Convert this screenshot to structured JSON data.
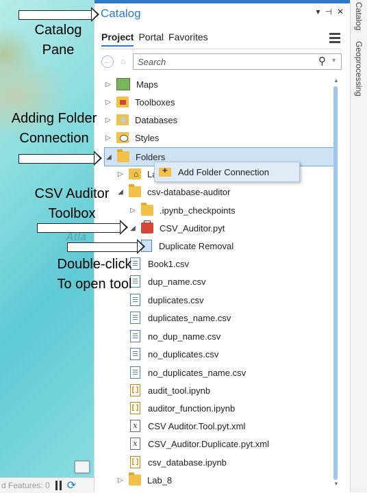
{
  "annotations": {
    "catalog_pane": [
      "Catalog",
      "Pane"
    ],
    "adding_folder": [
      "Adding Folder",
      "Connection"
    ],
    "csv_auditor": [
      "CSV Auditor",
      "Toolbox"
    ],
    "double_click": [
      "Double-click",
      "To open tool"
    ]
  },
  "map": {
    "status_text": "d Features: 0",
    "label_fragment": "Atla"
  },
  "pane": {
    "title": "Catalog",
    "controls": [
      "▾",
      "⊣",
      "✕"
    ],
    "tabs": [
      {
        "label": "Project",
        "active": true
      },
      {
        "label": "Portal",
        "active": false
      },
      {
        "label": "Favorites",
        "active": false
      }
    ],
    "search": {
      "placeholder": "Search",
      "value": ""
    }
  },
  "tree": [
    {
      "label": "Maps",
      "icon": "maps-folder-icon",
      "expanded": false
    },
    {
      "label": "Toolboxes",
      "icon": "toolbox-folder-icon",
      "expanded": false
    },
    {
      "label": "Databases",
      "icon": "database-folder-icon",
      "expanded": false
    },
    {
      "label": "Styles",
      "icon": "styles-folder-icon",
      "expanded": false
    },
    {
      "label": "Folders",
      "icon": "folder-icon",
      "expanded": true,
      "selected": true
    },
    {
      "label": "La",
      "icon": "home-folder-icon",
      "expanded": false
    },
    {
      "label": "csv-database-auditor",
      "icon": "folder-icon",
      "expanded": true
    },
    {
      "label": ".ipynb_checkpoints",
      "icon": "folder-icon",
      "expanded": false
    },
    {
      "label": "CSV_Auditor.pyt",
      "icon": "python-toolbox-icon",
      "expanded": true
    },
    {
      "label": "Duplicate Removal",
      "icon": "script-tool-icon"
    },
    {
      "label": "Book1.csv",
      "icon": "csv-file-icon"
    },
    {
      "label": "dup_name.csv",
      "icon": "csv-file-icon"
    },
    {
      "label": "duplicates.csv",
      "icon": "csv-file-icon"
    },
    {
      "label": "duplicates_name.csv",
      "icon": "csv-file-icon"
    },
    {
      "label": "no_dup_name.csv",
      "icon": "csv-file-icon"
    },
    {
      "label": "no_duplicates.csv",
      "icon": "csv-file-icon"
    },
    {
      "label": "no_duplicates_name.csv",
      "icon": "csv-file-icon"
    },
    {
      "label": "audit_tool.ipynb",
      "icon": "notebook-icon"
    },
    {
      "label": "auditor_function.ipynb",
      "icon": "notebook-icon"
    },
    {
      "label": "CSV Auditor.Tool.pyt.xml",
      "icon": "xml-file-icon"
    },
    {
      "label": "CSV_Auditor.Duplicate.pyt.xml",
      "icon": "xml-file-icon"
    },
    {
      "label": "csv_database.ipynb",
      "icon": "notebook-icon"
    },
    {
      "label": "Lab_8",
      "icon": "folder-icon",
      "expanded": false
    }
  ],
  "context_menu": {
    "item": "Add Folder Connection"
  },
  "side_tabs": [
    "Catalog",
    "Geoprocessing"
  ],
  "colors": {
    "accent": "#2a7bd0",
    "selection": "#cfe3f5"
  }
}
